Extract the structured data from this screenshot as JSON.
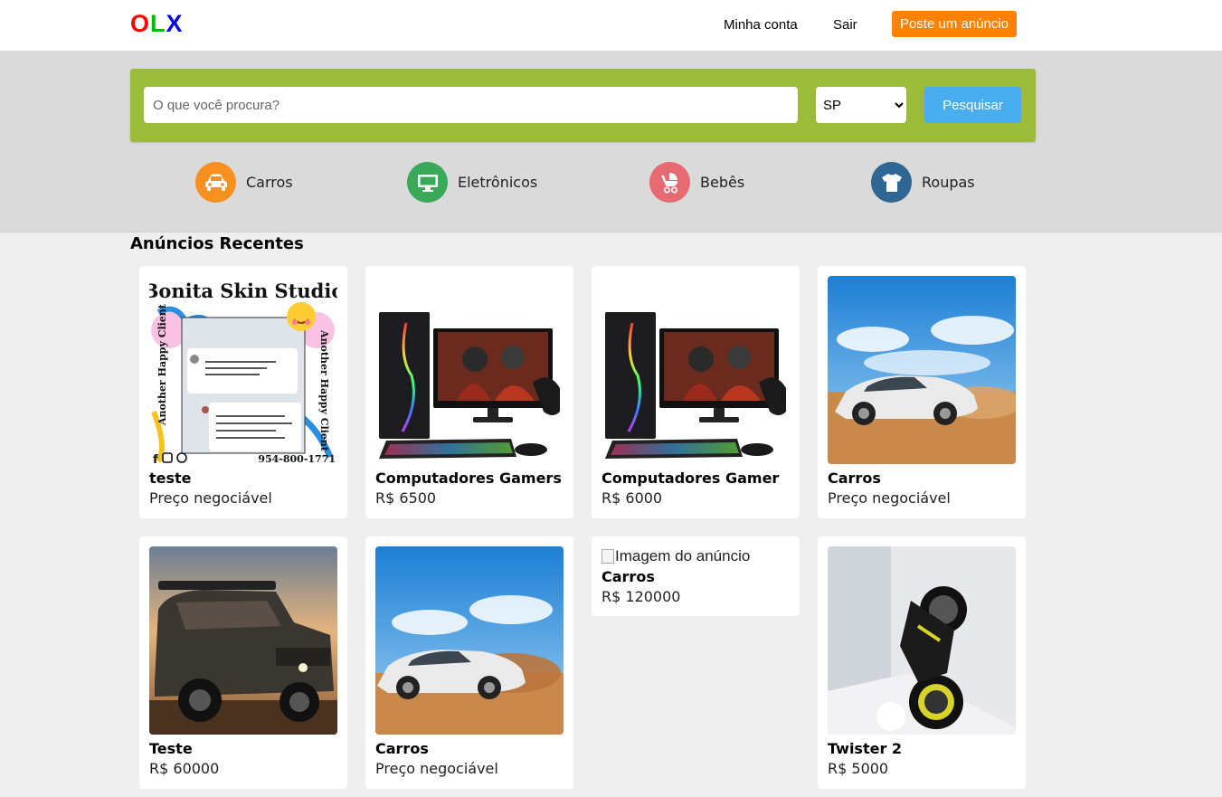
{
  "header": {
    "logo": [
      "O",
      "L",
      "X"
    ],
    "nav": {
      "account": "Minha conta",
      "logout": "Sair",
      "post_ad": "Poste um anúncio"
    }
  },
  "search": {
    "placeholder": "O que você procura?",
    "value": "",
    "state_selected": "SP",
    "button": "Pesquisar"
  },
  "categories": [
    {
      "label": "Carros",
      "icon": "car-icon",
      "color": "#f7901e"
    },
    {
      "label": "Eletrônicos",
      "icon": "monitor-icon",
      "color": "#3aaa5a"
    },
    {
      "label": "Bebês",
      "icon": "stroller-icon",
      "color": "#e76a73"
    },
    {
      "label": "Roupas",
      "icon": "shirt-icon",
      "color": "#2e6694"
    }
  ],
  "recent": {
    "title": "Anúncios Recentes",
    "ads": [
      {
        "title": "teste",
        "price": "Preço negociável",
        "image": "skin-studio-poster",
        "poster": {
          "heading": "Bonita Skin Studio",
          "side": "Another Happy Client",
          "phone": "954-800-1771"
        }
      },
      {
        "title": "Computadores Gamers",
        "price": "R$ 6500",
        "image": "gaming-pc"
      },
      {
        "title": "Computadores Gamer",
        "price": "R$ 6000",
        "image": "gaming-pc"
      },
      {
        "title": "Carros",
        "price": "Preço negociável",
        "image": "white-sedan"
      },
      {
        "title": "Teste",
        "price": "R$ 60000",
        "image": "pickup-truck"
      },
      {
        "title": "Carros",
        "price": "Preço negociável",
        "image": "white-sedan"
      },
      {
        "title": "Carros",
        "price": "R$ 120000",
        "image": "broken-image",
        "alt": "Imagem do anúncio"
      },
      {
        "title": "Twister 2",
        "price": "R$ 5000",
        "image": "motorcycle"
      }
    ]
  }
}
